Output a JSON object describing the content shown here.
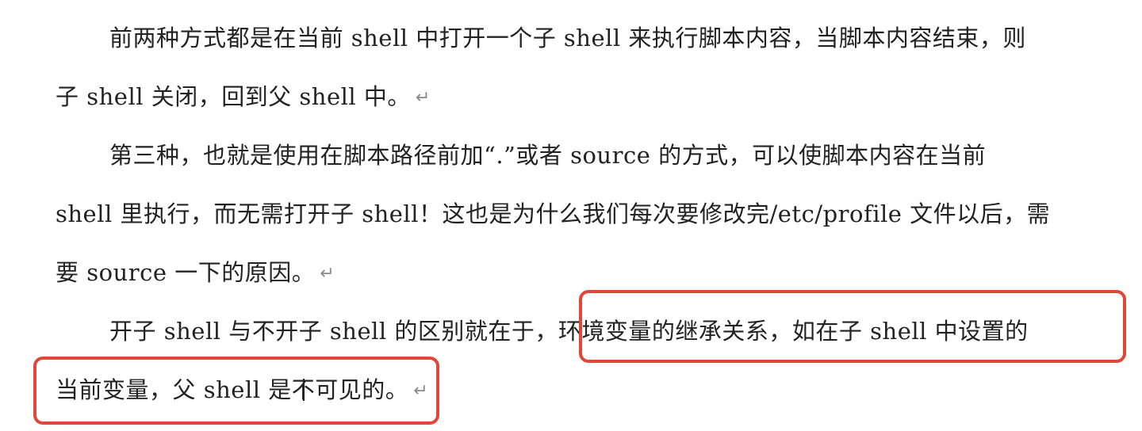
{
  "paragraph_mark": "↵",
  "lines": [
    "前两种方式都是在当前 shell 中打开一个子 shell 来执行脚本内容，当脚本内容结束，则",
    "子 shell 关闭，回到父 shell 中。",
    "第三种，也就是使用在脚本路径前加“.”或者 source 的方式，可以使脚本内容在当前",
    "shell 里执行，而无需打开子 shell！这也是为什么我们每次要修改完/etc/profile 文件以后，需",
    "要 source 一下的原因。",
    "开子 shell 与不开子 shell 的区别就在于，环境变量的继承关系，如在子 shell 中设置的",
    "当前变量，父 shell 是不可见的。"
  ],
  "highlight_color": "#e0473a"
}
